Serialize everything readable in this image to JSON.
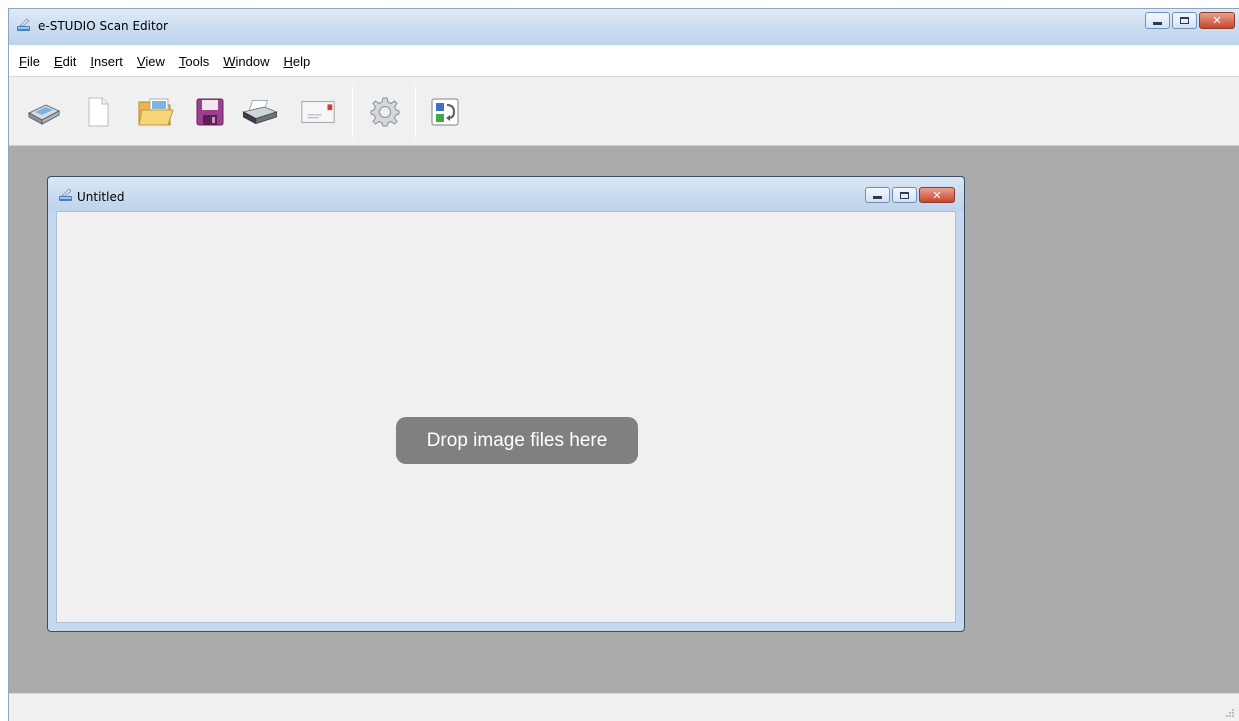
{
  "window": {
    "title": "e-STUDIO Scan Editor",
    "icon": "scan-editor-icon",
    "controls": {
      "minimize": "minimize-icon",
      "maximize": "maximize-icon",
      "close": "close-icon"
    }
  },
  "menu": {
    "items": [
      {
        "label": "File",
        "accel": "F",
        "rest": "ile"
      },
      {
        "label": "Edit",
        "accel": "E",
        "rest": "dit"
      },
      {
        "label": "Insert",
        "accel": "I",
        "rest": "nsert"
      },
      {
        "label": "View",
        "accel": "V",
        "rest": "iew"
      },
      {
        "label": "Tools",
        "accel": "T",
        "rest": "ools"
      },
      {
        "label": "Window",
        "accel": "W",
        "rest": "indow"
      },
      {
        "label": "Help",
        "accel": "H",
        "rest": "elp"
      }
    ]
  },
  "toolbar": {
    "buttons": [
      {
        "name": "scan",
        "icon": "scanner-icon"
      },
      {
        "name": "new",
        "icon": "new-document-icon"
      },
      {
        "name": "open",
        "icon": "open-folder-icon"
      },
      {
        "name": "save",
        "icon": "save-icon"
      },
      {
        "name": "print",
        "icon": "printer-icon"
      },
      {
        "name": "email",
        "icon": "envelope-icon"
      },
      {
        "name": "settings",
        "icon": "gear-icon"
      },
      {
        "name": "convert",
        "icon": "convert-icon"
      }
    ]
  },
  "document": {
    "title": "Untitled",
    "icon": "document-window-icon",
    "drop_hint": "Drop image files here"
  },
  "colors": {
    "mdi_background": "#ababab",
    "drop_hint_background": "#808080",
    "close_button": "#c8462c"
  }
}
